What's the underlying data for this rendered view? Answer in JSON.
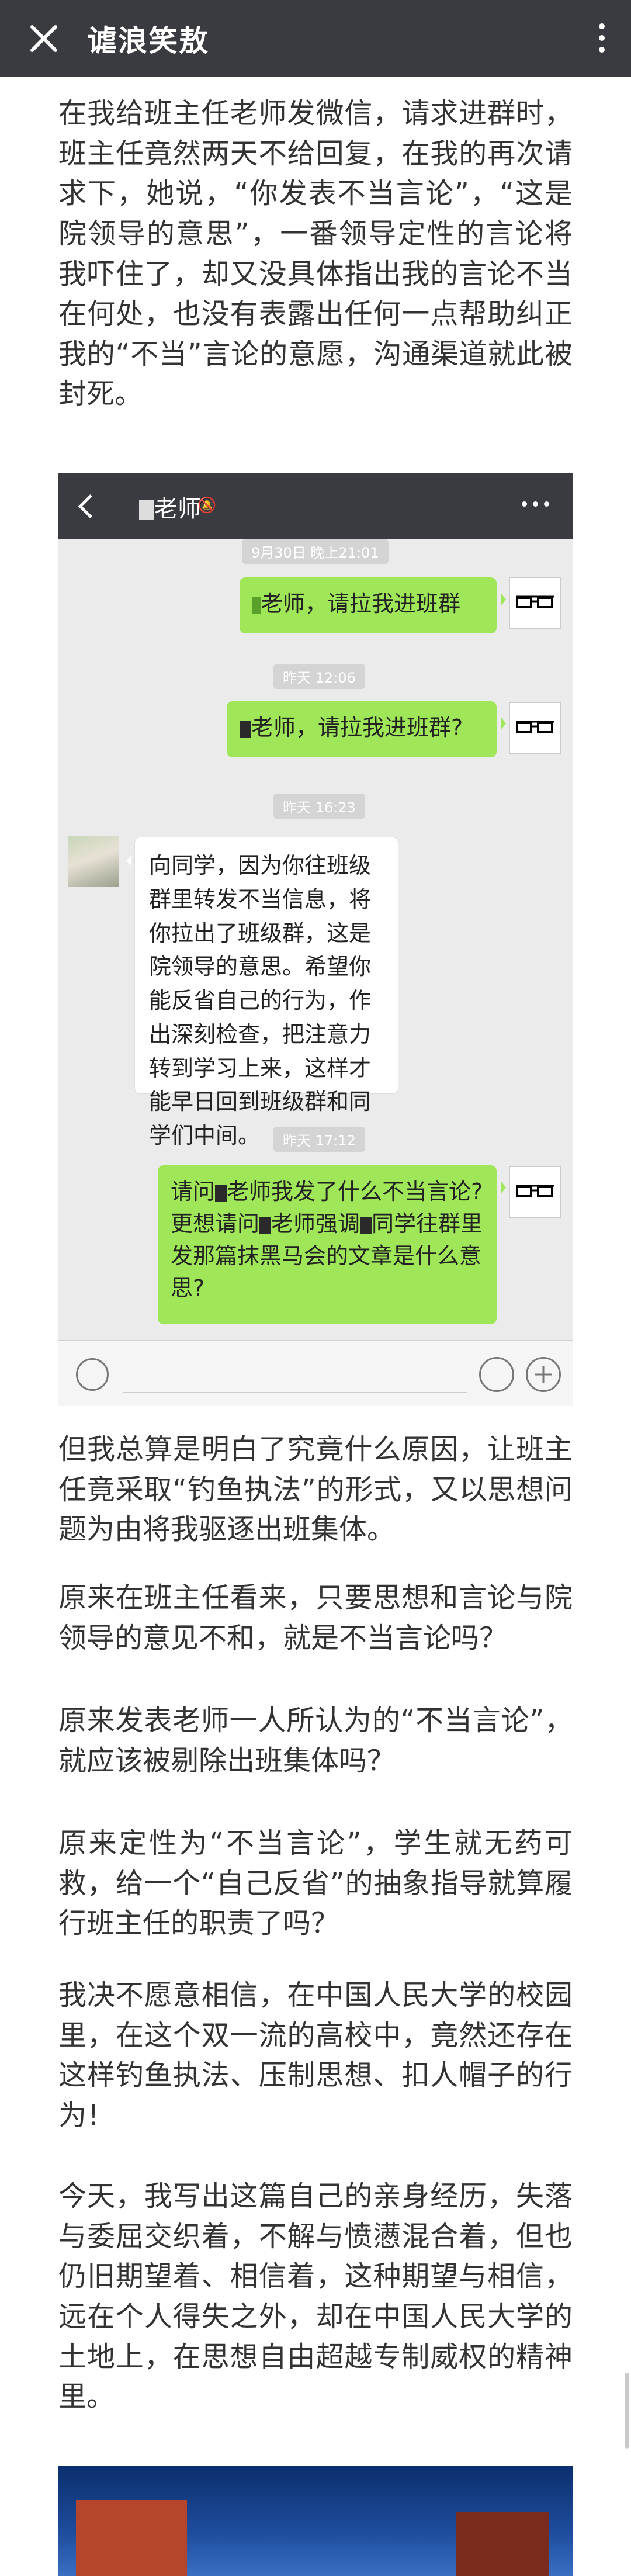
{
  "topbar": {
    "title": "谑浪笑敖"
  },
  "paragraphs": [
    "在我给班主任老师发微信，请求进群时，班主任竟然两天不给回复，在我的再次请求下，她说，“你发表不当言论”，“这是院领导的意思”，一番领导定性的言论将我吓住了，却又没具体指出我的言论不当在何处，也没有表露出任何一点帮助纠正我的“不当”言论的意愿，沟通渠道就此被封死。",
    "但我总算是明白了究竟什么原因，让班主任竟采取“钓鱼执法”的形式，又以思想问题为由将我驱逐出班集体。",
    "原来在班主任看来，只要思想和言论与院领导的意见不和，就是不当言论吗？",
    "原来发表老师一人所认为的“不当言论”，就应该被剔除出班集体吗？",
    "原来定性为“不当言论”，学生就无药可救，给一个“自己反省”的抽象指导就算履行班主任的职责了吗？",
    "我决不愿意相信，在中国人民大学的校园里，在这个双一流的高校中，竟然还存在这样钓鱼执法、压制思想、扣人帽子的行为！",
    "今天，我写出这篇自己的亲身经历，失落与委屈交织着，不解与愤懑混合着，但也仍旧期望着、相信着，这种期望与相信，远在个人得失之外，却在中国人民大学的土地上，在思想自由超越专制威权的精神里。"
  ],
  "chat": {
    "header_name": "老师",
    "timestamps": [
      "9月30日 晚上21:01",
      "昨天 12:06",
      "昨天 16:23",
      "昨天 17:12"
    ],
    "msg1": "老师，请拉我进班群",
    "msg2": "老师，请拉我进班群?",
    "msg3": "向同学，因为你往班级群里转发不当信息，将你拉出了班级群，这是院领导的意思。希望你能反省自己的行为，作出深刻检查，把注意力转到学习上来，这样才能早日回到班级群和同学们中间。",
    "msg4_parts": [
      "请问",
      "老师我发了什么不当言论?更想请问",
      "老师强调",
      "同学往群里发那篇抹黑马会的文章是什么意思?"
    ]
  },
  "icons": [
    "close-icon",
    "more-icon",
    "back-icon",
    "mute-icon",
    "voice-icon",
    "emoji-icon",
    "plus-icon"
  ]
}
